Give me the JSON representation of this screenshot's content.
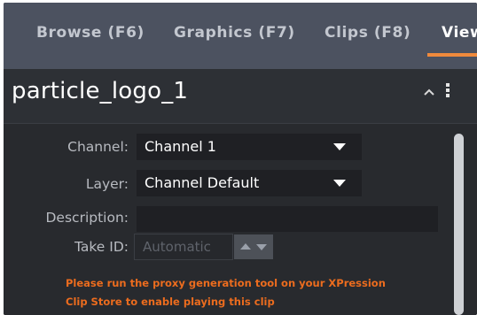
{
  "tabs": [
    {
      "label": "Browse (F6)"
    },
    {
      "label": "Graphics (F7)"
    },
    {
      "label": "Clips (F8)"
    },
    {
      "label": "View"
    }
  ],
  "active_tab_index": 3,
  "panel": {
    "title": "particle_logo_1",
    "collapse_icon": "chevron-up-icon",
    "menu_icon": "vertical-ellipsis-icon"
  },
  "form": {
    "channel": {
      "label": "Channel:",
      "value": "Channel 1"
    },
    "layer": {
      "label": "Layer:",
      "value": "Channel Default"
    },
    "description": {
      "label": "Description:",
      "value": ""
    },
    "take_id": {
      "label": "Take ID:",
      "placeholder": "Automatic"
    }
  },
  "warning": {
    "line1": "Please run the proxy generation tool on your XPression",
    "line2": "Clip Store to enable playing this clip"
  },
  "colors": {
    "accent": "#f08a3c",
    "warning": "#ec6c1e",
    "tab_bar": "#4c5260",
    "panel_bg": "#282a2e"
  }
}
